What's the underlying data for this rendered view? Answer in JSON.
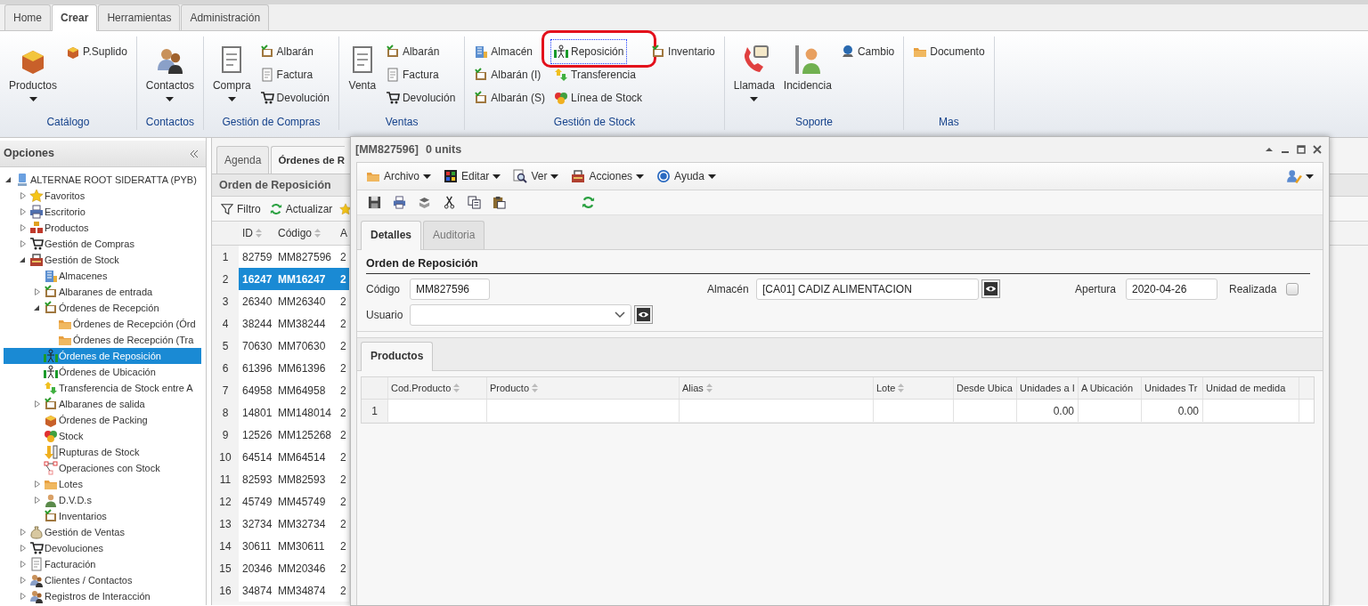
{
  "main_tabs": [
    {
      "label": "Home",
      "selected": false
    },
    {
      "label": "Crear",
      "selected": true
    },
    {
      "label": "Herramientas",
      "selected": false
    },
    {
      "label": "Administración",
      "selected": false
    }
  ],
  "ribbon_groups": [
    {
      "label": "Catálogo",
      "items": [
        {
          "kind": "large",
          "label": "Productos",
          "dropdown": true
        },
        {
          "kind": "column",
          "buttons": [
            {
              "label": "P.Suplido",
              "highlighted": false
            }
          ]
        }
      ]
    },
    {
      "label": "Contactos",
      "items": [
        {
          "kind": "large",
          "label": "Contactos",
          "dropdown": true
        }
      ]
    },
    {
      "label": "Gestión de Compras",
      "items": [
        {
          "kind": "large",
          "label": "Compra",
          "dropdown": true
        },
        {
          "kind": "column",
          "buttons": [
            {
              "label": "Albarán",
              "highlighted": false
            },
            {
              "label": "Factura",
              "highlighted": false
            },
            {
              "label": "Devolución",
              "highlighted": false
            }
          ]
        }
      ]
    },
    {
      "label": "Ventas",
      "items": [
        {
          "kind": "large",
          "label": "Venta",
          "dropdown": false
        },
        {
          "kind": "column",
          "buttons": [
            {
              "label": "Albarán",
              "highlighted": false
            },
            {
              "label": "Factura",
              "highlighted": false
            },
            {
              "label": "Devolución",
              "highlighted": false
            }
          ]
        }
      ]
    },
    {
      "label": "Gestión de Stock",
      "items": [
        {
          "kind": "column",
          "buttons": [
            {
              "label": "Almacén",
              "highlighted": false
            },
            {
              "label": "Albarán (I)",
              "highlighted": false
            },
            {
              "label": "Albarán (S)",
              "highlighted": false
            }
          ]
        },
        {
          "kind": "column",
          "buttons": [
            {
              "label": "Reposición",
              "highlighted": true
            },
            {
              "label": "Transferencia",
              "highlighted": false
            },
            {
              "label": "Línea de Stock",
              "highlighted": false
            }
          ]
        },
        {
          "kind": "column",
          "buttons": [
            {
              "label": "Inventario",
              "highlighted": false
            }
          ]
        }
      ]
    },
    {
      "label": "Soporte",
      "items": [
        {
          "kind": "large",
          "label": "Llamada",
          "dropdown": true
        },
        {
          "kind": "large",
          "label": "Incidencia",
          "dropdown": false
        },
        {
          "kind": "column",
          "buttons": [
            {
              "label": "Cambio",
              "highlighted": false
            }
          ]
        }
      ]
    },
    {
      "label": "Mas",
      "items": [
        {
          "kind": "column",
          "buttons": [
            {
              "label": "Documento",
              "highlighted": false
            }
          ]
        }
      ]
    }
  ],
  "sidebar": {
    "title": "Opciones",
    "tree": [
      {
        "label": "ALTERNAE ROOT SIDERATTA (PYB)",
        "expanded": true,
        "selected": false,
        "children": [
          {
            "label": "Favoritos",
            "expanded": false,
            "selected": false
          },
          {
            "label": "Escritorio",
            "expanded": false,
            "selected": false
          },
          {
            "label": "Productos",
            "expanded": false,
            "selected": false
          },
          {
            "label": "Gestión de Compras",
            "expanded": false,
            "selected": false
          },
          {
            "label": "Gestión de Stock",
            "expanded": true,
            "selected": false,
            "children": [
              {
                "label": "Almacenes",
                "selected": false
              },
              {
                "label": "Albaranes de entrada",
                "expanded": false,
                "selected": false
              },
              {
                "label": "Órdenes de Recepción",
                "expanded": true,
                "selected": false,
                "children": [
                  {
                    "label": "Órdenes de Recepción (Órd",
                    "selected": false
                  },
                  {
                    "label": "Órdenes de Recepción (Tra",
                    "selected": false
                  }
                ]
              },
              {
                "label": "Órdenes de Reposición",
                "selected": true
              },
              {
                "label": "Órdenes de Ubicación",
                "selected": false
              },
              {
                "label": "Transferencia de Stock entre A",
                "selected": false
              },
              {
                "label": "Albaranes de salida",
                "expanded": false,
                "selected": false
              },
              {
                "label": "Órdenes de Packing",
                "selected": false
              },
              {
                "label": "Stock",
                "selected": false
              },
              {
                "label": "Rupturas de Stock",
                "selected": false
              },
              {
                "label": "Operaciones con Stock",
                "selected": false
              },
              {
                "label": "Lotes",
                "expanded": false,
                "selected": false
              },
              {
                "label": "D.V.D.s",
                "expanded": false,
                "selected": false
              },
              {
                "label": "Inventarios",
                "selected": false
              }
            ]
          },
          {
            "label": "Gestión de Ventas",
            "expanded": false,
            "selected": false
          },
          {
            "label": "Devoluciones",
            "expanded": false,
            "selected": false
          },
          {
            "label": "Facturación",
            "expanded": false,
            "selected": false
          },
          {
            "label": "Clientes / Contactos",
            "expanded": false,
            "selected": false
          },
          {
            "label": "Registros de Interacción",
            "expanded": false,
            "selected": false
          }
        ]
      }
    ]
  },
  "workspace": {
    "tabs": [
      {
        "label": "Agenda",
        "selected": false
      },
      {
        "label": "Órdenes de R",
        "selected": true
      }
    ],
    "panel_title": "Orden de Reposición",
    "toolbar": [
      "Filtro",
      "Actualizar"
    ],
    "table": {
      "columns": [
        {
          "label": "ID",
          "sortable": true
        },
        {
          "label": "Código",
          "sortable": true
        },
        {
          "label": "A"
        }
      ],
      "rows": [
        {
          "number": "1",
          "cells": [
            "82759",
            "MM827596",
            "2"
          ],
          "selected": false
        },
        {
          "number": "2",
          "cells": [
            "16247",
            "MM16247",
            "2"
          ],
          "selected": true
        },
        {
          "number": "3",
          "cells": [
            "26340",
            "MM26340",
            "2"
          ],
          "selected": false
        },
        {
          "number": "4",
          "cells": [
            "38244",
            "MM38244",
            "2"
          ],
          "selected": false
        },
        {
          "number": "5",
          "cells": [
            "70630",
            "MM70630",
            "2"
          ],
          "selected": false
        },
        {
          "number": "6",
          "cells": [
            "61396",
            "MM61396",
            "2"
          ],
          "selected": false
        },
        {
          "number": "7",
          "cells": [
            "64958",
            "MM64958",
            "2"
          ],
          "selected": false
        },
        {
          "number": "8",
          "cells": [
            "14801",
            "MM148014",
            "2"
          ],
          "selected": false
        },
        {
          "number": "9",
          "cells": [
            "12526",
            "MM125268",
            "2"
          ],
          "selected": false
        },
        {
          "number": "10",
          "cells": [
            "64514",
            "MM64514",
            "2"
          ],
          "selected": false
        },
        {
          "number": "11",
          "cells": [
            "82593",
            "MM82593",
            "2"
          ],
          "selected": false
        },
        {
          "number": "12",
          "cells": [
            "45749",
            "MM45749",
            "2"
          ],
          "selected": false
        },
        {
          "number": "13",
          "cells": [
            "32734",
            "MM32734",
            "2"
          ],
          "selected": false
        },
        {
          "number": "14",
          "cells": [
            "30611",
            "MM30611",
            "2"
          ],
          "selected": false
        },
        {
          "number": "15",
          "cells": [
            "20346",
            "MM20346",
            "2"
          ],
          "selected": false
        },
        {
          "number": "16",
          "cells": [
            "34874",
            "MM34874",
            "2"
          ],
          "selected": false
        }
      ]
    }
  },
  "dialog": {
    "title": "[MM827596]",
    "subtitle": "0 units",
    "menu": [
      "Archivo",
      "Editar",
      "Ver",
      "Acciones",
      "Ayuda"
    ],
    "tabs": [
      {
        "label": "Detalles",
        "selected": true
      },
      {
        "label": "Auditoria",
        "selected": false
      }
    ],
    "section_title": "Orden de Reposición",
    "field_rows": [
      [
        {
          "kind": "text",
          "label": "Código",
          "value": "MM827596"
        },
        {
          "kind": "lookup",
          "label": "Almacén",
          "value": "[CA01] CADIZ ALIMENTACION"
        },
        {
          "kind": "text",
          "label": "Apertura",
          "value": "2020-04-26"
        },
        {
          "kind": "checkbox",
          "label": "Realizada",
          "checked": false
        }
      ],
      [
        {
          "kind": "select",
          "label": "Usuario"
        }
      ]
    ],
    "detail_tabs": [
      {
        "label": "Productos",
        "selected": true
      }
    ],
    "table": {
      "columns": [
        {
          "label": "Cod.Producto",
          "sortable": true
        },
        {
          "label": "Producto",
          "sortable": true
        },
        {
          "label": "Alias",
          "sortable": true
        },
        {
          "label": "Lote",
          "sortable": true
        },
        {
          "label": "Desde Ubica"
        },
        {
          "label": "Unidades a I"
        },
        {
          "label": "A Ubicación",
          "sortable": false
        },
        {
          "label": "Unidades Tr",
          "sortable": false
        },
        {
          "label": "Unidad de medida",
          "sortable": false
        }
      ],
      "rows": [
        {
          "number": "1",
          "cells": [
            null,
            null,
            null,
            null,
            null,
            "0.00",
            null,
            "0.00",
            null
          ]
        }
      ]
    }
  }
}
